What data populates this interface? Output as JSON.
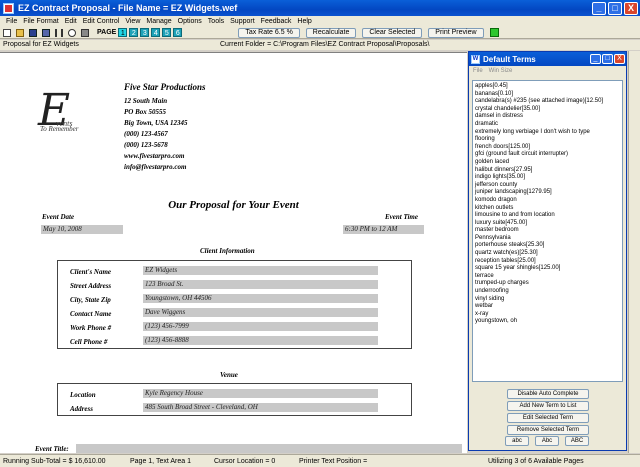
{
  "window": {
    "title": "EZ Contract Proposal - File Name = EZ Widgets.wef",
    "min": "_",
    "max": "□",
    "close": "X"
  },
  "menu": [
    "File",
    "File Format",
    "Edit",
    "Edit Control",
    "View",
    "Manage",
    "Options",
    "Tools",
    "Support",
    "Feedback",
    "Help"
  ],
  "toolbar": {
    "page_label": "PAGE",
    "pages": [
      "1",
      "2",
      "3",
      "4",
      "5",
      "6"
    ],
    "tax_rate": "Tax Rate 6.5 %",
    "recalculate": "Recalculate",
    "clear_selected": "Clear Selected",
    "print_preview": "Print Preview"
  },
  "info": {
    "left": "Proposal for EZ Widgets",
    "folder": "Current Folder = C:\\Program Files\\EZ Contract Proposal\\Proposals\\"
  },
  "company": {
    "name": "Five Star Productions",
    "lines": [
      "12 South Main",
      "PO Box 50555",
      "Big Town, USA 12345",
      "(000) 123-4567",
      "(000) 123-5678",
      "www.fivestarpro.com",
      "info@fivestarpro.com"
    ],
    "logo_letter": "E",
    "logo_word": "vents",
    "logo_tagline": "To Remember"
  },
  "proposal": {
    "title": "Our Proposal for Your Event",
    "event_date_label": "Event Date",
    "event_date": "May 10, 2008",
    "event_time_label": "Event Time",
    "event_time": "6:30 PM to 12 AM",
    "client_info_head": "Client Information",
    "client_fields": [
      {
        "label": "Client's Name",
        "value": "EZ Widgets"
      },
      {
        "label": "Street Address",
        "value": "123 Broad St."
      },
      {
        "label": "City, State Zip",
        "value": "Youngstown, OH 44506"
      },
      {
        "label": "Contact Name",
        "value": "Dave Wiggens"
      },
      {
        "label": "Work Phone #",
        "value": "(123) 456-7999"
      },
      {
        "label": "Cell Phone #",
        "value": "(123) 456-8888"
      }
    ],
    "venue_head": "Venue",
    "venue_fields": [
      {
        "label": "Location",
        "value": "Kyle Regency House"
      },
      {
        "label": "Address",
        "value": "485 South Broad Street - Cleveland, OH"
      }
    ],
    "event_title_label": "Event Title:"
  },
  "panel": {
    "title": "Default Terms",
    "menu": [
      "File",
      "Win Size"
    ],
    "terms": [
      "apples[0.45]",
      "bananas[0.10]",
      "candelabra(s) #235 (see attached image)[12.50]",
      "crystal chandelier[35.00]",
      "damsel in distress",
      "dramatic",
      "extremely long verbiage I don't wish to type",
      "flooring",
      "french doors[125.00]",
      "gfci (ground fault circuit interrupter)",
      "golden laced",
      "halibut dinners[27.95]",
      "indigo lights[35.00]",
      "jefferson county",
      "juniper landscaping[1279.95]",
      "komodo dragon",
      "kitchen outlets",
      "limousine to and from location",
      "luxury suite[475.00]",
      "master bedroom",
      "Pennsylvania",
      "porterhouse steaks[25.30]",
      "quartz watch(es)[25.30]",
      "reception tables[25.00]",
      "square 15 year shingles[125.00]",
      "terrace",
      "trumped-up charges",
      "underroofing",
      "vinyl siding",
      "wetbar",
      "x-ray",
      "youngstown, oh"
    ],
    "buttons": [
      "Disable Auto Complete",
      "Add New Term to List",
      "Edit Selected Term",
      "Remove Selected Term"
    ],
    "case_buttons": [
      "abc",
      "Abc",
      "ABC"
    ]
  },
  "status": {
    "subtotal": "Running Sub-Total = $ 16,610.00",
    "page": "Page 1, Text Area 1",
    "cursor": "Cursor Location = 0",
    "printer": "Printer Text Position =",
    "pages": "Utilizing 3 of 6 Available Pages"
  }
}
